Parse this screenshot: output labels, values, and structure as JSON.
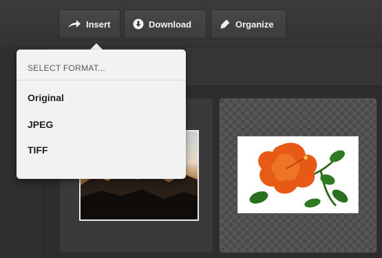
{
  "toolbar": {
    "buttons": [
      {
        "label": "Insert",
        "icon": "arrow-right-icon"
      },
      {
        "label": "Download",
        "icon": "download-icon"
      },
      {
        "label": "Organize",
        "icon": "pen-icon"
      }
    ]
  },
  "format_menu": {
    "header": "SELECT FORMAT...",
    "items": [
      "Original",
      "JPEG",
      "TIFF"
    ]
  },
  "gallery": {
    "items": [
      {
        "name": "landscape-image"
      },
      {
        "name": "hibiscus-flower-image"
      }
    ]
  },
  "colors": {
    "toolbar_bg": "#3b3b3b",
    "menu_bg": "#f2f2f2",
    "menu_text": "#1f1f1f",
    "flower": "#e65a16"
  }
}
